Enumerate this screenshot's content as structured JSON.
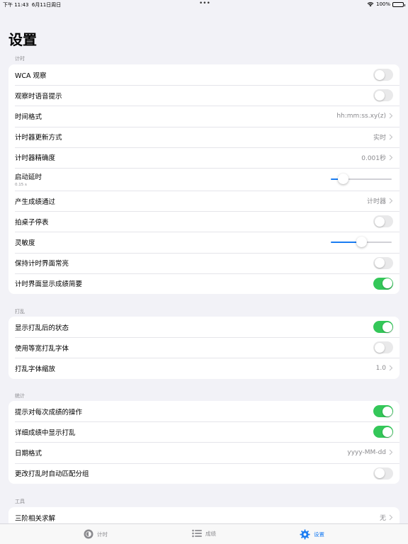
{
  "status": {
    "time": "下午 11:43",
    "date": "6月11日周日",
    "battery": "100%",
    "battery_level": 1.0
  },
  "title": "设置",
  "sections": {
    "timing": {
      "header": "计时",
      "wca_inspection": "WCA 观察",
      "inspection_voice": "观察时语音提示",
      "time_format": "时间格式",
      "time_format_value": "hh:mm:ss.xy(z)",
      "timer_update": "计时器更新方式",
      "timer_update_value": "实时",
      "timer_precision": "计时器精确度",
      "timer_precision_value": "0.001秒",
      "start_delay": "启动延时",
      "start_delay_value": "0.15 s",
      "start_delay_level": 0.2,
      "generate_via": "产生成绩通过",
      "generate_via_value": "计时器",
      "tap_stop": "拍桌子停表",
      "sensitivity": "灵敏度",
      "sensitivity_level": 0.5,
      "keep_awake": "保持计时界面常亮",
      "show_summary": "计时界面显示成绩简要"
    },
    "scramble": {
      "header": "打乱",
      "show_state": "显示打乱后的状态",
      "monospace_font": "使用等宽打乱字体",
      "font_scale": "打乱字体缩放",
      "font_scale_value": "1.0"
    },
    "stats": {
      "header": "统计",
      "prompt_action": "提示对每次成绩的操作",
      "show_scramble_detail": "详细成绩中显示打乱",
      "date_format": "日期格式",
      "date_format_value": "yyyy-MM-dd",
      "auto_group": "更改打乱时自动匹配分组"
    },
    "tools": {
      "header": "工具",
      "three_solver": "三阶相关求解",
      "three_solver_value": "无"
    }
  },
  "tabs": {
    "timer": "计时",
    "results": "成绩",
    "settings": "设置"
  },
  "colors": {
    "accent": "#1a7cf2",
    "toggle_on": "#34c759",
    "toggle_off": "#e9e9ea",
    "background": "#f2f2f7"
  },
  "icons": [
    "wifi-icon",
    "battery-icon",
    "chevron-right-icon",
    "timer-icon",
    "list-icon",
    "gear-icon"
  ]
}
